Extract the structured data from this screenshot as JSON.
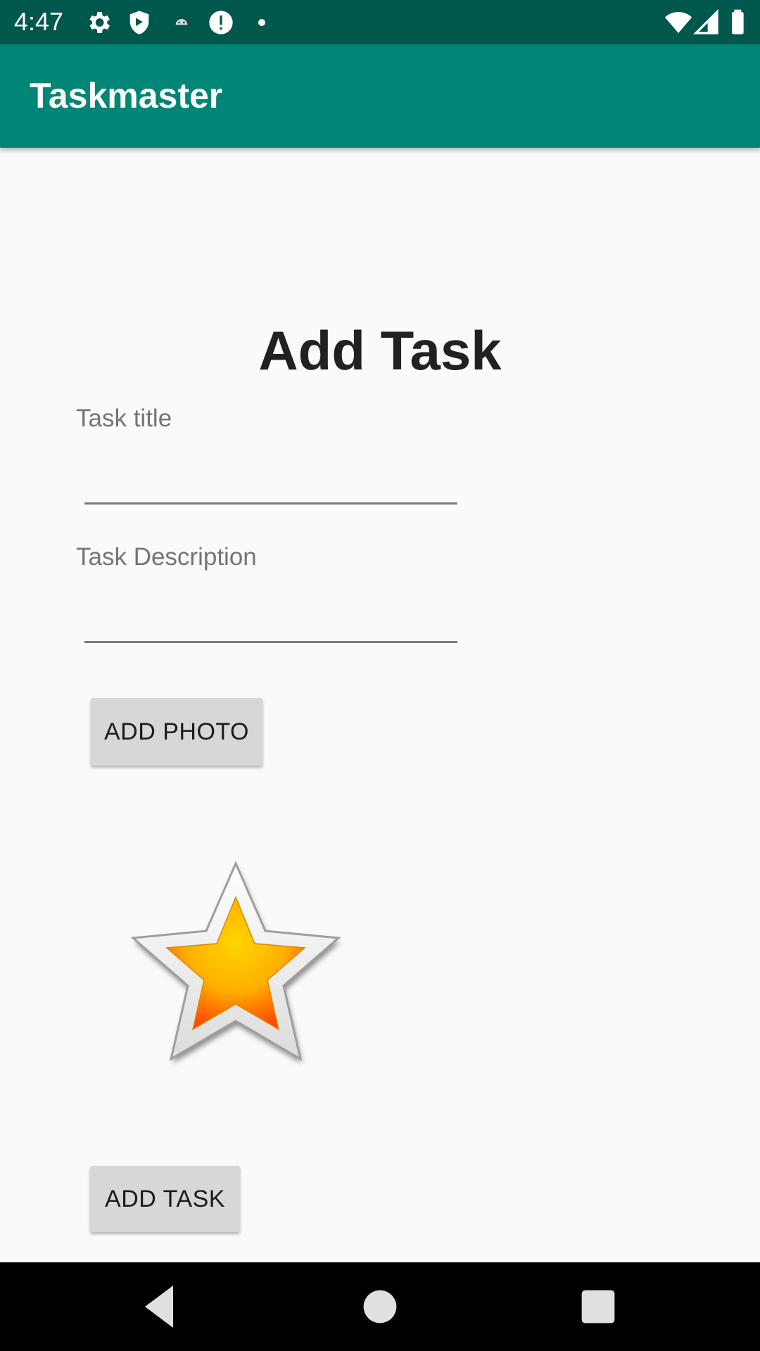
{
  "status_bar": {
    "time": "4:47",
    "icons_left": [
      "gear-icon",
      "shield-icon",
      "android-icon",
      "alert-icon",
      "dot-icon"
    ],
    "icons_right": [
      "wifi-icon",
      "signal-icon",
      "battery-icon"
    ]
  },
  "app_bar": {
    "title": "Taskmaster",
    "color": "#008577",
    "status_color": "#00574b"
  },
  "main": {
    "heading": "Add Task",
    "title_field": {
      "label": "Task title",
      "value": ""
    },
    "description_field": {
      "label": "Task Description",
      "value": ""
    },
    "add_photo_label": "ADD PHOTO",
    "photo_icon": "star-icon",
    "add_task_label": "ADD TASK"
  },
  "nav_bar": {
    "buttons": [
      "back-icon",
      "home-icon",
      "recents-icon"
    ]
  }
}
